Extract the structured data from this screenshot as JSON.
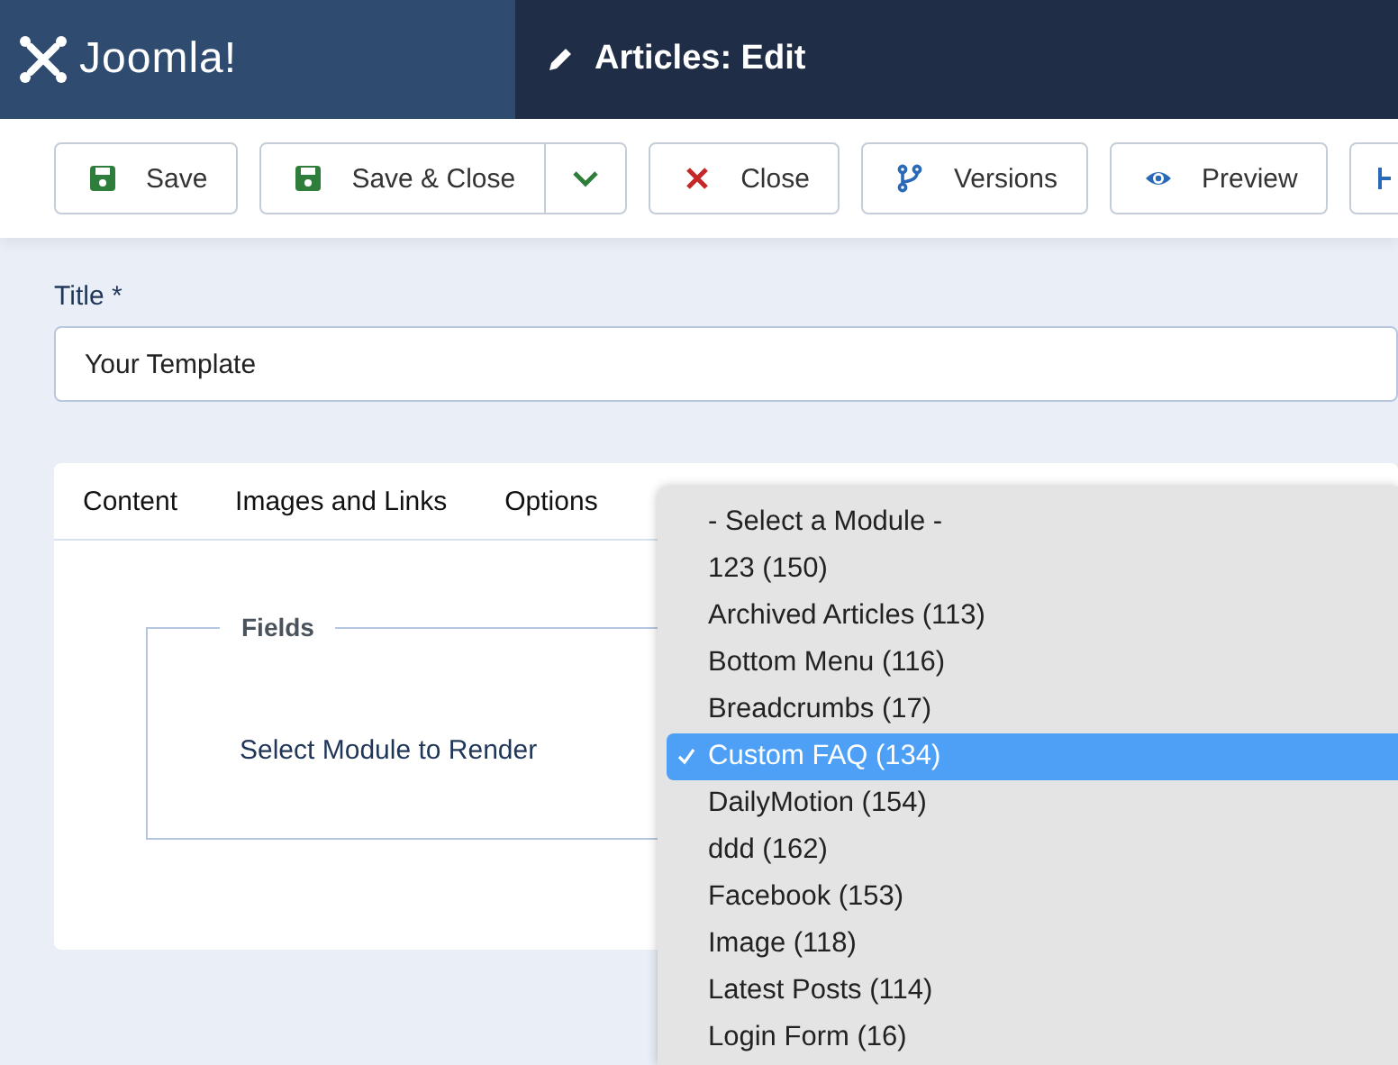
{
  "header": {
    "logo_text": "Joomla!",
    "page_title": "Articles: Edit"
  },
  "toolbar": [
    {
      "kind": "save",
      "label": "Save"
    },
    {
      "kind": "split",
      "label": "Save & Close"
    },
    {
      "kind": "close",
      "label": "Close"
    },
    {
      "kind": "versions",
      "label": "Versions"
    },
    {
      "kind": "preview",
      "label": "Preview"
    },
    {
      "kind": "partial"
    }
  ],
  "title_field": {
    "label": "Title *",
    "value": "Your Template"
  },
  "tabs": [
    {
      "label": "Content",
      "selected": false
    },
    {
      "label": "Images and Links",
      "selected": false
    },
    {
      "label": "Options",
      "selected": false
    }
  ],
  "fieldset": {
    "legend": "Fields",
    "text": "Select Module to Render"
  },
  "module_dropdown": {
    "options": [
      {
        "label": "- Select a Module -",
        "selected": false
      },
      {
        "label": "123 (150)",
        "selected": false
      },
      {
        "label": "Archived Articles (113)",
        "selected": false
      },
      {
        "label": "Bottom Menu (116)",
        "selected": false
      },
      {
        "label": "Breadcrumbs (17)",
        "selected": false
      },
      {
        "label": "Custom FAQ (134)",
        "selected": true
      },
      {
        "label": "DailyMotion (154)",
        "selected": false
      },
      {
        "label": "ddd (162)",
        "selected": false
      },
      {
        "label": "Facebook (153)",
        "selected": false
      },
      {
        "label": "Image (118)",
        "selected": false
      },
      {
        "label": "Latest Posts (114)",
        "selected": false
      },
      {
        "label": "Login Form (16)",
        "selected": false
      }
    ]
  }
}
